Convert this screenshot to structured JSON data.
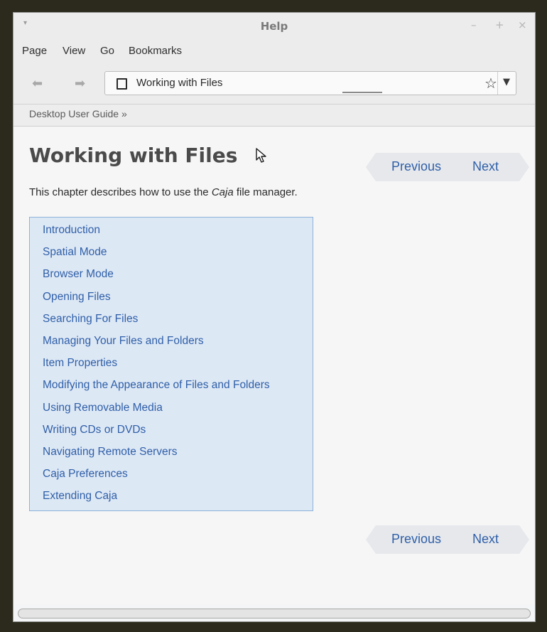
{
  "window": {
    "title": "Help",
    "controls": {
      "minimize": "–",
      "maximize": "+",
      "close": "×"
    },
    "menu_glyph": "▾"
  },
  "menubar": {
    "items": [
      "Page",
      "View",
      "Go",
      "Bookmarks"
    ]
  },
  "toolbar": {
    "back_glyph": "⬅",
    "forward_glyph": "➡",
    "url_text": "Working with Files",
    "star_glyph": "☆",
    "dropdown_glyph": "▼"
  },
  "breadcrumb": {
    "text": "Desktop User Guide »"
  },
  "page": {
    "title": "Working with Files",
    "intro_before": "This chapter describes how to use the ",
    "intro_em": "Caja",
    "intro_after": " file manager.",
    "nav_top": {
      "previous": "Previous",
      "next": "Next"
    },
    "nav_bottom": {
      "previous": "Previous",
      "next": "Next"
    },
    "toc": [
      "Introduction",
      "Spatial Mode",
      "Browser Mode",
      "Opening Files",
      "Searching For Files",
      "Managing Your Files and Folders",
      "Item Properties",
      "Modifying the Appearance of Files and Folders",
      "Using Removable Media",
      "Writing CDs or DVDs",
      "Navigating Remote Servers",
      "Caja Preferences",
      "Extending Caja"
    ]
  },
  "colors": {
    "link": "#2f5fa8",
    "toc_background": "#dde8f5",
    "toc_border": "#8eb1d8",
    "nav_background": "#e6e8ec"
  }
}
